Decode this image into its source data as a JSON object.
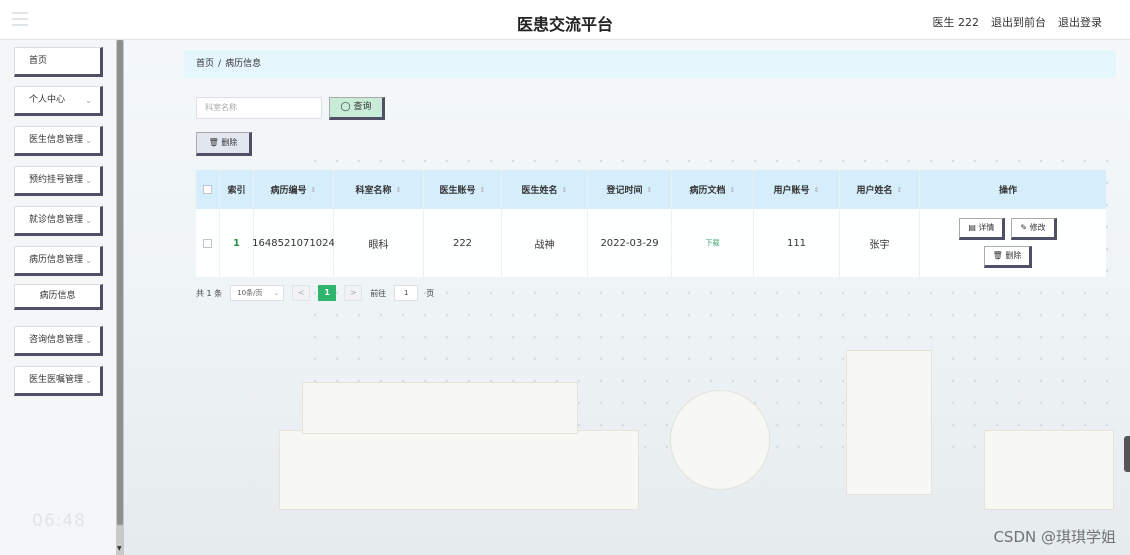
{
  "app": {
    "title": "医患交流平台"
  },
  "header": {
    "user": "医生 222",
    "back_to_front": "退出到前台",
    "logout": "退出登录"
  },
  "sidebar": {
    "items": [
      {
        "label": "首页",
        "chev": ""
      },
      {
        "label": "个人中心",
        "chev": "⌄"
      },
      {
        "label": "医生信息管理",
        "chev": "⌄"
      },
      {
        "label": "预约挂号管理",
        "chev": "⌄"
      },
      {
        "label": "就诊信息管理",
        "chev": "⌄"
      },
      {
        "label": "病历信息管理",
        "chev": "⌄"
      },
      {
        "label": "病历信息",
        "chev": ""
      },
      {
        "label": "咨询信息管理",
        "chev": "⌄"
      },
      {
        "label": "医生医嘱管理",
        "chev": "⌄"
      }
    ],
    "clock": "06:48"
  },
  "breadcrumb": {
    "home": "首页",
    "sep": "/",
    "current": "病历信息"
  },
  "search": {
    "placeholder": "科室名称",
    "query_label": "◯ 查询"
  },
  "toolbar": {
    "delete_label": "🗑 删除"
  },
  "table": {
    "headers": [
      "",
      "索引",
      "病历编号",
      "科室名称",
      "医生账号",
      "医生姓名",
      "登记时间",
      "病历文档",
      "用户账号",
      "用户姓名",
      "操作"
    ],
    "sort_mark": "⇕",
    "rows": [
      {
        "index": "1",
        "record_no": "1648521071024",
        "department": "眼科",
        "doctor_account": "222",
        "doctor_name": "战神",
        "register_time": "2022-03-29",
        "document": "下载",
        "user_account": "111",
        "user_name": "张宇",
        "actions": {
          "detail": "▤ 详情",
          "edit": "✎ 修改",
          "delete": "🗑 删除"
        }
      }
    ]
  },
  "pagination": {
    "total": "共 1 条",
    "page_size": "10条/页",
    "prev": "<",
    "current": "1",
    "next": ">",
    "goto_label": "前往",
    "goto_value": "1",
    "page_unit": "页"
  },
  "watermark": "CSDN @琪琪学姐"
}
